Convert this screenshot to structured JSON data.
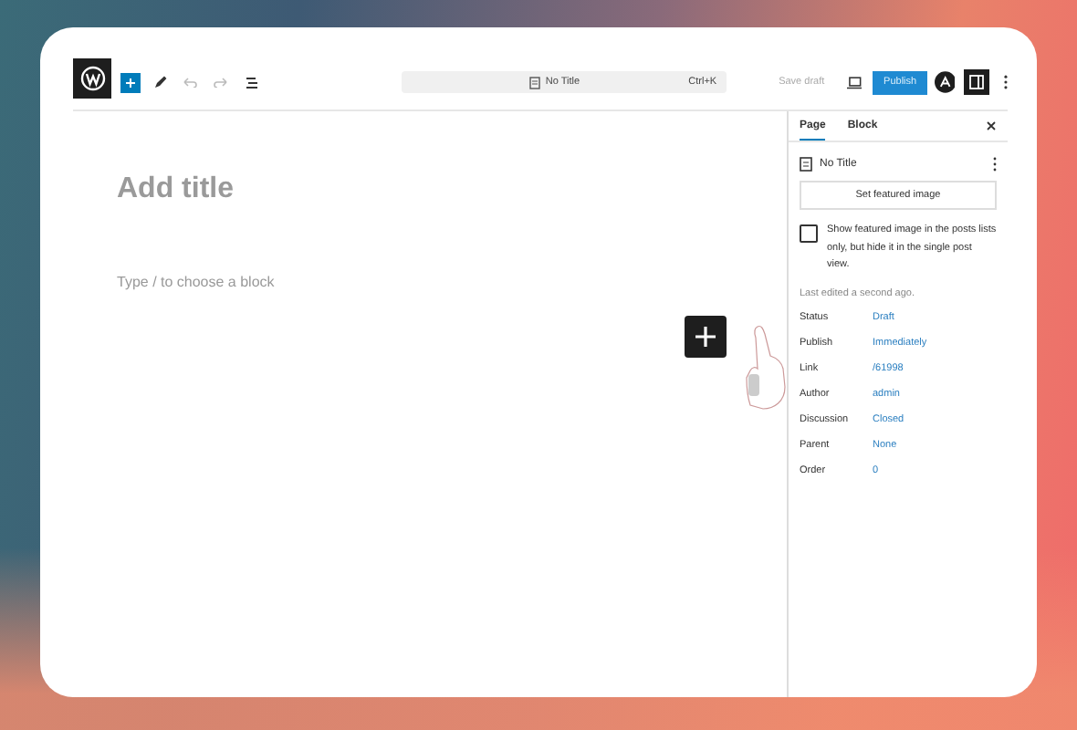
{
  "toolbar": {
    "document_title": "No Title",
    "shortcut": "Ctrl+K",
    "save_draft": "Save draft",
    "publish": "Publish",
    "settings_open": true
  },
  "editor": {
    "title_placeholder": "Add title",
    "block_placeholder": "Type / to choose a block"
  },
  "sidebar": {
    "tabs": [
      {
        "label": "Page",
        "selected": true
      },
      {
        "label": "Block",
        "selected": false
      }
    ],
    "post_title": "No Title",
    "featured_button": "Set featured image",
    "featured_option": {
      "label": "Show featured image in the posts lists only, but hide it in the single post view.",
      "checked": false
    },
    "last_edited": "Last edited a second ago.",
    "rows": [
      {
        "label": "Status",
        "value": "Draft"
      },
      {
        "label": "Publish",
        "value": "Immediately"
      },
      {
        "label": "Link",
        "value": "/61998"
      },
      {
        "label": "Author",
        "value": "admin"
      },
      {
        "label": "Discussion",
        "value": "Closed"
      },
      {
        "label": "Parent",
        "value": "None"
      },
      {
        "label": "Order",
        "value": "0"
      }
    ]
  }
}
